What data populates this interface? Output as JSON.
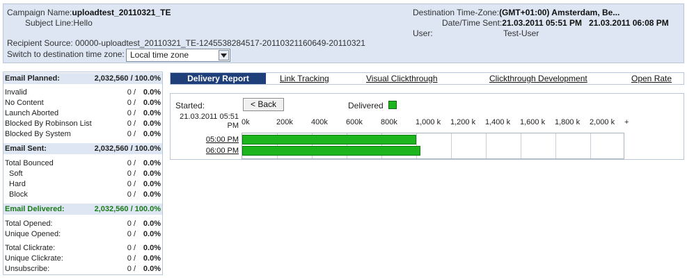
{
  "header": {
    "campaign_name_label": "Campaign Name:",
    "campaign_name": "uploadtest_20110321_TE",
    "subject_label": "Subject Line:",
    "subject": "Hello",
    "recipient_source": "Recipient Source: 00000-uploadtest_20110321_TE-1245538284517-20110321160649-20110321",
    "switch_label": "Switch to destination time zone:",
    "tz_select_value": "Local time zone",
    "dest_tz_label": "Destination Time-Zone:",
    "dest_tz_value": "(GMT+01:00) Amsterdam, Be...",
    "datetime_label": "Date/Time Sent:",
    "datetime_start": "21.03.2011 05:51 PM",
    "datetime_end": "21.03.2011 06:08 PM",
    "user_label": "User:",
    "user_value": "Test-User"
  },
  "stats": {
    "planned": {
      "label": "Email Planned:",
      "value": "2,032,560 / 100.0%"
    },
    "planned_rows": [
      {
        "label": "Invalid",
        "num": "0 /",
        "pct": "0.0%"
      },
      {
        "label": "No Content",
        "num": "0 /",
        "pct": "0.0%"
      },
      {
        "label": "Launch Aborted",
        "num": "0 /",
        "pct": "0.0%"
      },
      {
        "label": "Blocked By Robinson List",
        "num": "0 /",
        "pct": "0.0%"
      },
      {
        "label": "Blocked By System",
        "num": "0 /",
        "pct": "0.0%"
      }
    ],
    "sent": {
      "label": "Email Sent:",
      "value": "2,032,560 / 100.0%"
    },
    "sent_rows": [
      {
        "label": "Total Bounced",
        "num": "0 /",
        "pct": "0.0%"
      },
      {
        "label": "Soft",
        "num": "0 /",
        "pct": "0.0%"
      },
      {
        "label": "Hard",
        "num": "0 /",
        "pct": "0.0%"
      },
      {
        "label": "Block",
        "num": "0 /",
        "pct": "0.0%"
      }
    ],
    "delivered": {
      "label": "Email Delivered:",
      "value": "2,032,560 / 100.0%"
    },
    "opened_rows": [
      {
        "label": "Total Opened:",
        "num": "0 /",
        "pct": "0.0%"
      },
      {
        "label": "Unique Opened:",
        "num": "0 /",
        "pct": "0.0%"
      }
    ],
    "click_rows": [
      {
        "label": "Total Clickrate:",
        "num": "0 /",
        "pct": "0.0%"
      },
      {
        "label": "Unique Clickrate:",
        "num": "0 /",
        "pct": "0.0%"
      },
      {
        "label": "Unsubscribe:",
        "num": "0 /",
        "pct": "0.0%"
      }
    ]
  },
  "tabs": [
    "Delivery Report",
    "Link Tracking",
    "Visual Clickthrough",
    "Clickthrough Development",
    "Open Rate"
  ],
  "report": {
    "started_label": "Started:",
    "started_time": "21.03.2011 05:51 PM",
    "back_label": "< Back",
    "legend_label": "Delivered",
    "delivered_color": "#1db51d"
  },
  "chart_data": {
    "type": "bar",
    "orientation": "horizontal",
    "x_tick_labels": [
      "0k",
      "200k",
      "400k",
      "600k",
      "800k",
      "1,000 k",
      "1,200 k",
      "1,400 k",
      "1,600 k",
      "1,800 k",
      "2,000 k",
      "+"
    ],
    "xlim": [
      0,
      2200000
    ],
    "categories": [
      "05:00 PM",
      "06:00 PM"
    ],
    "series": [
      {
        "name": "Delivered",
        "values": [
          1000000,
          1025000
        ]
      }
    ]
  }
}
